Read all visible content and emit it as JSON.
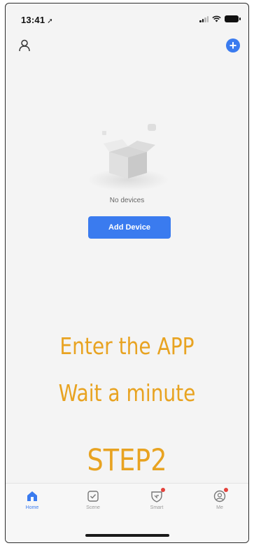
{
  "status_bar": {
    "time": "13:41",
    "location_arrow": "➚"
  },
  "header": {
    "profile_icon": "person-icon",
    "add_icon": "plus-circle-icon",
    "add_symbol": "+"
  },
  "empty_state": {
    "illustration": "empty-box-illustration",
    "message": "No devices",
    "button_label": "Add Device"
  },
  "overlay": {
    "line1": "Enter the APP",
    "line2": "Wait a minute",
    "line3": "STEP2",
    "color": "#e8a321"
  },
  "tab_bar": {
    "items": [
      {
        "label": "Home",
        "icon": "home-icon",
        "active": true
      },
      {
        "label": "Scene",
        "icon": "scene-icon",
        "active": false
      },
      {
        "label": "Smart",
        "icon": "smart-icon",
        "active": false,
        "badge": true
      },
      {
        "label": "Me",
        "icon": "me-icon",
        "active": false,
        "badge": true
      }
    ]
  },
  "colors": {
    "accent": "#3a7bef",
    "badge": "#e4423c",
    "background": "#f4f4f4"
  }
}
